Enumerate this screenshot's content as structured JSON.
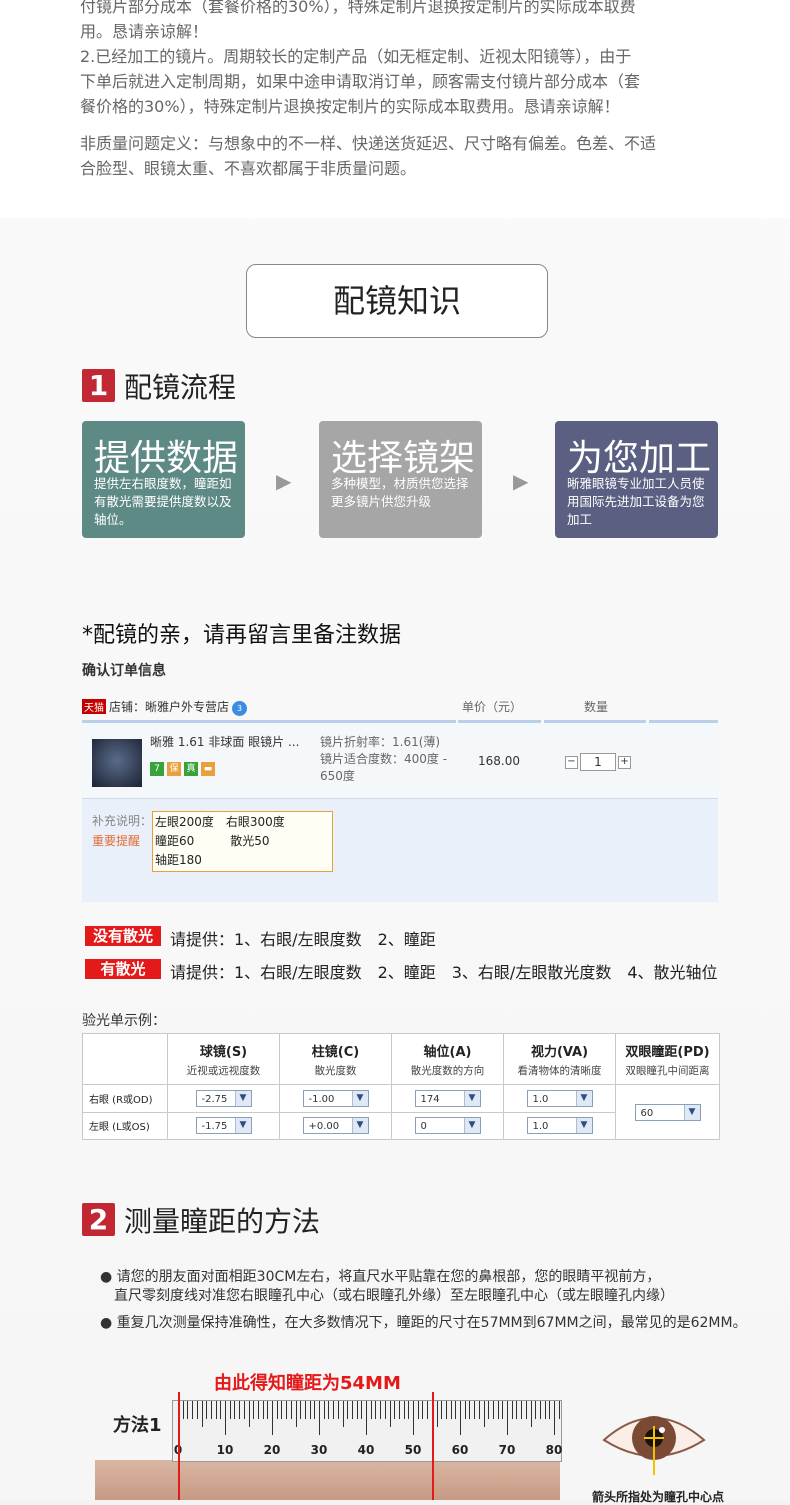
{
  "intro": {
    "lines": [
      "付镜片部分成本（套餐价格的30%），特殊定制片退换按定制片的实际成本取费",
      "用。恳请亲谅解！",
      "2.已经加工的镜片。周期较长的定制产品（如无框定制、近视太阳镜等），由于",
      "下单后就进入定制周期，如果中途申请取消订单，顾客需支付镜片部分成本（套",
      "餐价格的30%），特殊定制片退换按定制片的实际成本取费用。恳请亲谅解！"
    ],
    "nonquality": [
      "非质量问题定义：与想象中的不一样、快递送货延迟、尺寸略有偏差。色差、不适",
      "合脸型、眼镜太重、不喜欢都属于非质量问题。"
    ]
  },
  "section_title": "配镜知识",
  "section1": {
    "num": "1",
    "title": "配镜流程"
  },
  "steps": [
    {
      "title": "提供数据",
      "desc": "提供左右眼度数，瞳距如有散光需要提供度数以及轴位。",
      "color": "#5e8a86"
    },
    {
      "title": "选择镜架",
      "desc": "多种模型，材质供您选择更多镜片供您升级",
      "color": "#a6a6a6"
    },
    {
      "title": "为您加工",
      "desc": "晰雅眼镜专业加工人员使用国际先进加工设备为您加工",
      "color": "#5b5f82"
    }
  ],
  "arrow": "▶",
  "note": "*配镜的亲，请再留言里备注数据",
  "confirm": "确认订单信息",
  "order": {
    "tmall": "天猫",
    "shop": "店铺：晰雅户外专营店",
    "badge": "3",
    "col_price": "单价（元）",
    "col_qty": "数量",
    "product": "晰雅 1.61 非球面 眼镜片 ...",
    "attr1": "镜片折射率：1.61(薄)",
    "attr2": "镜片适合度数：400度 - 650度",
    "price": "168.00",
    "qty": "1",
    "minus": "−",
    "plus": "+",
    "supp_label": "补充说明：",
    "supp_warn": "重要提醒",
    "supp_lines": [
      "左眼200度　右眼300度",
      "瞳距60　　　散光50",
      "轴距180"
    ]
  },
  "tags": [
    {
      "label": "没有散光",
      "text": "请提供：1、右眼/左眼度数　2、瞳距"
    },
    {
      "label": "有散光",
      "text": "请提供：1、右眼/左眼度数　2、瞳距　3、右眼/左眼散光度数　4、散光轴位"
    }
  ],
  "rx": {
    "title": "验光单示例：",
    "headers": [
      {
        "main": "球镜(S)",
        "sub": "近视或远视度数"
      },
      {
        "main": "柱镜(C)",
        "sub": "散光度数"
      },
      {
        "main": "轴位(A)",
        "sub": "散光度数的方向"
      },
      {
        "main": "视力(VA)",
        "sub": "看清物体的清晰度"
      },
      {
        "main": "双眼瞳距(PD)",
        "sub": "双眼瞳孔中间距离"
      }
    ],
    "rows": [
      {
        "label": "右眼 (R或OD)",
        "s": "-2.75",
        "c": "-1.00",
        "a": "174",
        "va": "1.0"
      },
      {
        "label": "左眼 (L或OS)",
        "s": "-1.75",
        "c": "+0.00",
        "a": "0",
        "va": "1.0"
      }
    ],
    "pd": "60",
    "dropdown": "▼"
  },
  "section2": {
    "num": "2",
    "title": "测量瞳距的方法"
  },
  "bullets": [
    {
      "l1": "● 请您的朋友面对面相距30CM左右，将直尺水平贴靠在您的鼻根部，您的眼睛平视前方，",
      "l2": "直尺零刻度线对准您右眼瞳孔中心（或右眼瞳孔外缘）至左眼瞳孔中心（或左眼瞳孔内缘）"
    },
    {
      "l1": "● 重复几次测量保持准确性，在大多数情况下，瞳距的尺寸在57MM到67MM之间，最常见的是62MM。",
      "l2": ""
    }
  ],
  "ruler": {
    "result": "由此得知瞳距为54MM",
    "method": "方法1",
    "labels": [
      "0",
      "10",
      "20",
      "30",
      "40",
      "50",
      "60",
      "70",
      "80"
    ],
    "pd_mm": 54
  },
  "eye_caption": "箭头所指处为瞳孔中心点"
}
